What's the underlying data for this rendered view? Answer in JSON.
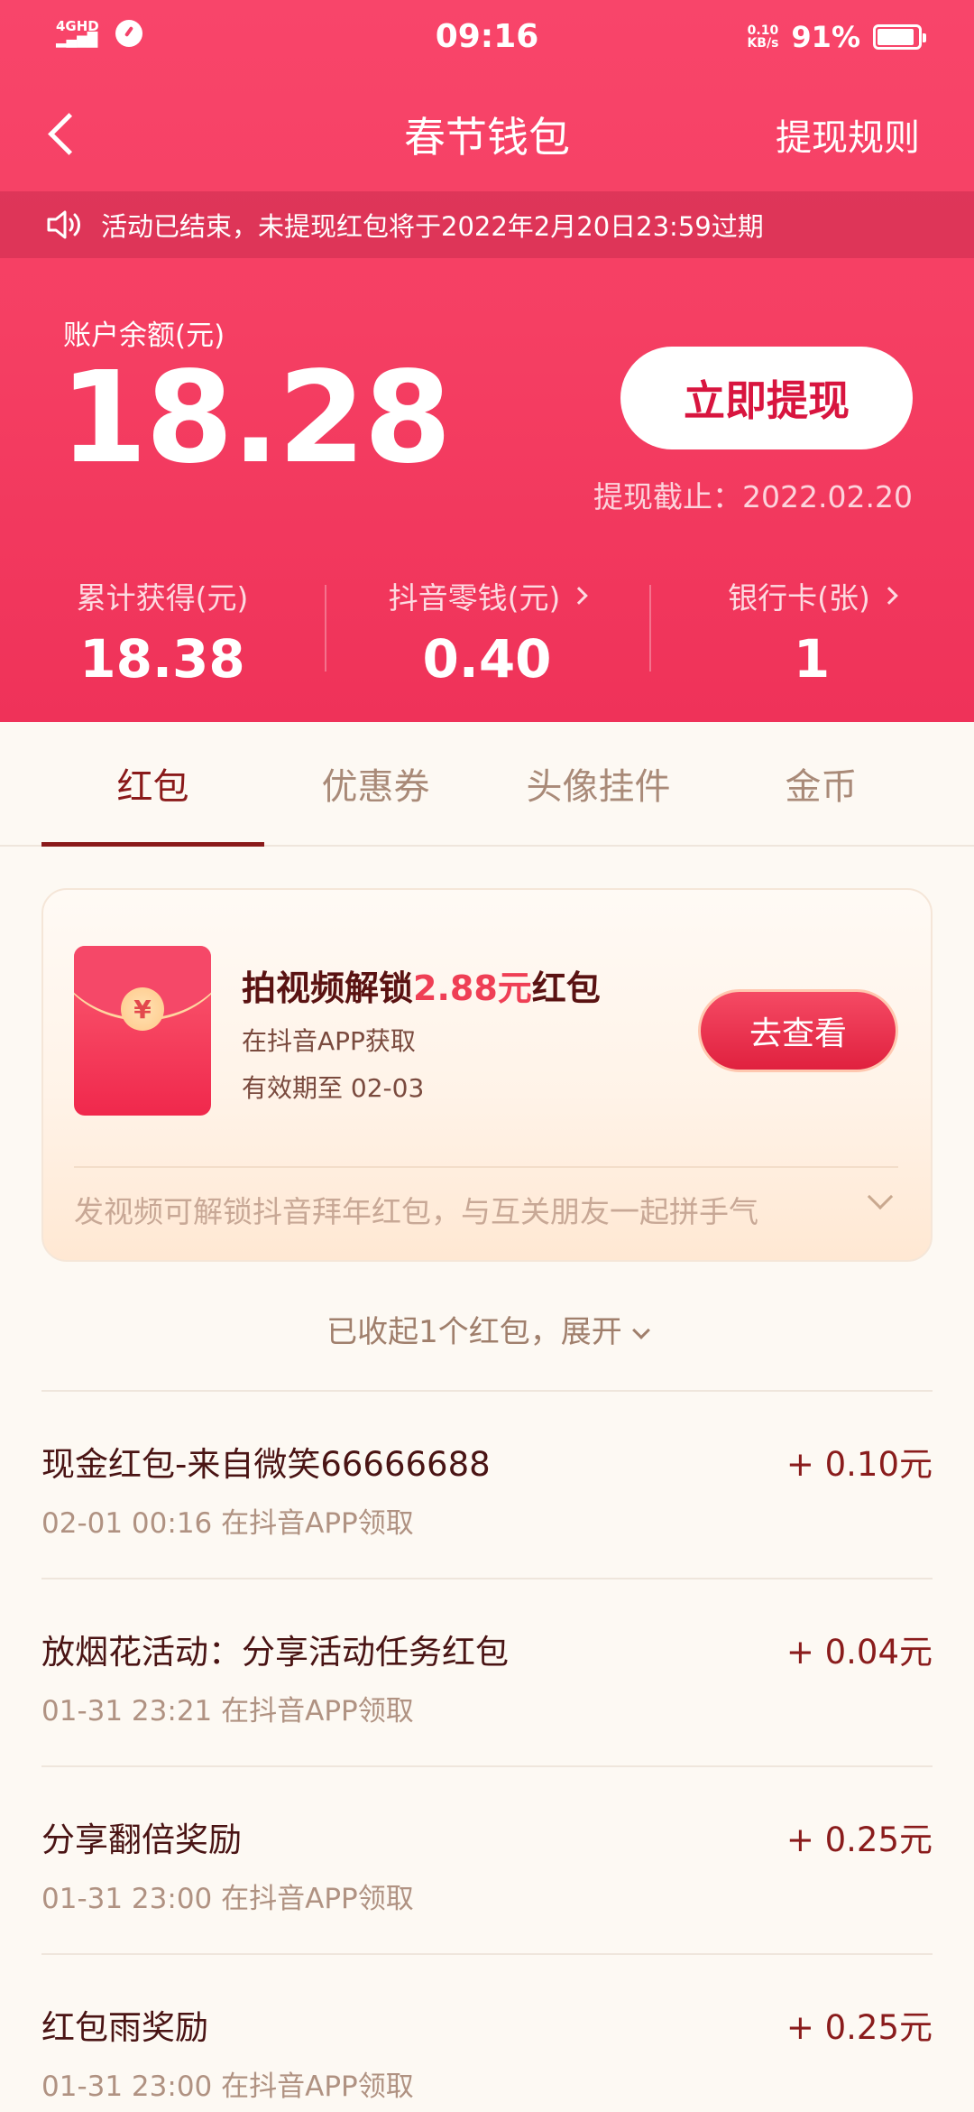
{
  "status_bar": {
    "network": "4GHD",
    "time": "09:16",
    "speed": "0.10",
    "speed_unit": "KB/s",
    "battery": "91%",
    "battery_level": 0.91
  },
  "nav": {
    "title": "春节钱包",
    "rule_link": "提现规则"
  },
  "notice": {
    "text": "活动已结束，未提现红包将于2022年2月20日23:59过期"
  },
  "balance": {
    "label": "账户余额(元)",
    "value": "18.28",
    "withdraw_button": "立即提现",
    "deadline": "提现截止：2022.02.20"
  },
  "stats": [
    {
      "label": "累计获得(元)",
      "value": "18.38",
      "has_arrow": false
    },
    {
      "label": "抖音零钱(元)",
      "value": "0.40",
      "has_arrow": true
    },
    {
      "label": "银行卡(张)",
      "value": "1",
      "has_arrow": true
    }
  ],
  "tabs": [
    {
      "label": "红包",
      "active": true
    },
    {
      "label": "优惠券",
      "active": false
    },
    {
      "label": "头像挂件",
      "active": false
    },
    {
      "label": "金币",
      "active": false
    }
  ],
  "promo_card": {
    "coin_symbol": "¥",
    "title_prefix": "拍视频解锁",
    "title_amount": "2.88元",
    "title_suffix": "红包",
    "source": "在抖音APP获取",
    "expiry": "有效期至 02-03",
    "button": "去查看",
    "tip": "发视频可解锁抖音拜年红包，与互关朋友一起拼手气"
  },
  "collapsed_text": "已收起1个红包，展开",
  "records": [
    {
      "title": "现金红包-来自微笑66666688",
      "subtitle": "02-01 00:16 在抖音APP领取",
      "amount": "+ 0.10元"
    },
    {
      "title": "放烟花活动：分享活动任务红包",
      "subtitle": "01-31 23:21 在抖音APP领取",
      "amount": "+ 0.04元"
    },
    {
      "title": "分享翻倍奖励",
      "subtitle": "01-31 23:00 在抖音APP领取",
      "amount": "+ 0.25元"
    },
    {
      "title": "红包雨奖励",
      "subtitle": "01-31 23:00 在抖音APP领取",
      "amount": "+ 0.25元"
    }
  ],
  "colors": {
    "hero": "#f53f63",
    "accent": "#8a1a1a",
    "background": "#fdf9f3"
  }
}
